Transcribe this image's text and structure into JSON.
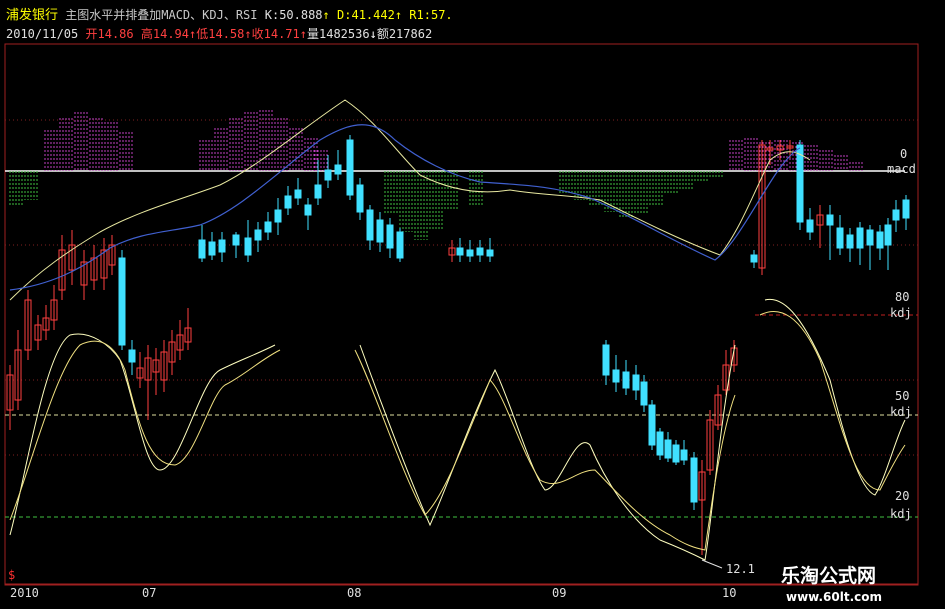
{
  "header": {
    "stock_name": "浦发银行",
    "description": "主图水平并排叠加MACD、KDJ、RSI",
    "k_label": "K:",
    "k_value": "50.888",
    "d_label": "D:",
    "d_value": "41.442",
    "r1_label": "R1:",
    "r1_value": "57."
  },
  "quote": {
    "date": "2010/11/05",
    "open_label": "开",
    "open": "14.86",
    "high_label": "高",
    "high": "14.94",
    "low_label": "低",
    "low": "14.58",
    "close_label": "收",
    "close": "14.71",
    "volume_label": "量",
    "volume": "1482536",
    "amount_label": "额",
    "amount": "217862"
  },
  "indicator_labels": {
    "macd_zero": "0",
    "macd": "macd",
    "kdj_80": "80",
    "kdj_50": "50",
    "kdj_20": "20",
    "kdj": "kdj"
  },
  "min_price_label": "12.1",
  "x_axis": [
    "2010",
    "07",
    "08",
    "09",
    "10"
  ],
  "watermark": {
    "name": "乐淘公式网",
    "url": "www.60lt.com"
  },
  "colors": {
    "up": "#ff4040",
    "down": "#40e0ff",
    "ma_short": "#e8e8a0",
    "ma_long": "#4060d0",
    "macd_pos": "#c040c0",
    "macd_neg": "#40c040",
    "zero_line": "#ffffff"
  },
  "chart_data": {
    "type": "candlestick",
    "period_labels": [
      "2010",
      "07",
      "08",
      "09",
      "10"
    ],
    "kdj_levels": [
      80,
      50,
      20
    ],
    "last_bar": {
      "open": 14.86,
      "high": 14.94,
      "low": 14.58,
      "close": 14.71
    },
    "k": 50.888,
    "d": 41.442
  }
}
